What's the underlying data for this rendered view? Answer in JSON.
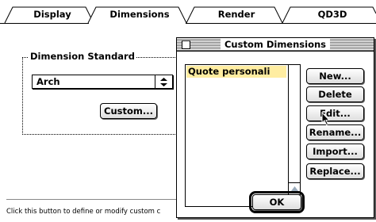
{
  "tabs": [
    {
      "label": "Display",
      "active": false
    },
    {
      "label": "Dimensions",
      "active": true
    },
    {
      "label": "Render",
      "active": false
    },
    {
      "label": "QD3D",
      "active": false
    }
  ],
  "main": {
    "group_title": "Dimension Standard",
    "standard_value": "Arch",
    "custom_button": "Custom...",
    "help_text": "Click this button to define or modify custom c"
  },
  "dialog": {
    "title": "Custom Dimensions",
    "list_items": [
      "Quote personali"
    ],
    "buttons": {
      "new": "New...",
      "delete": "Delete",
      "edit": "Edit...",
      "rename": "Rename...",
      "import": "Import...",
      "replace": "Replace..."
    },
    "ok_button": "OK"
  },
  "colors": {
    "selection_highlight": "#ffeda1"
  },
  "icons": [
    "popup-arrows-icon",
    "close-box-icon",
    "scroll-up-arrow-icon",
    "scroll-down-arrow-icon",
    "arrow-cursor-icon"
  ]
}
